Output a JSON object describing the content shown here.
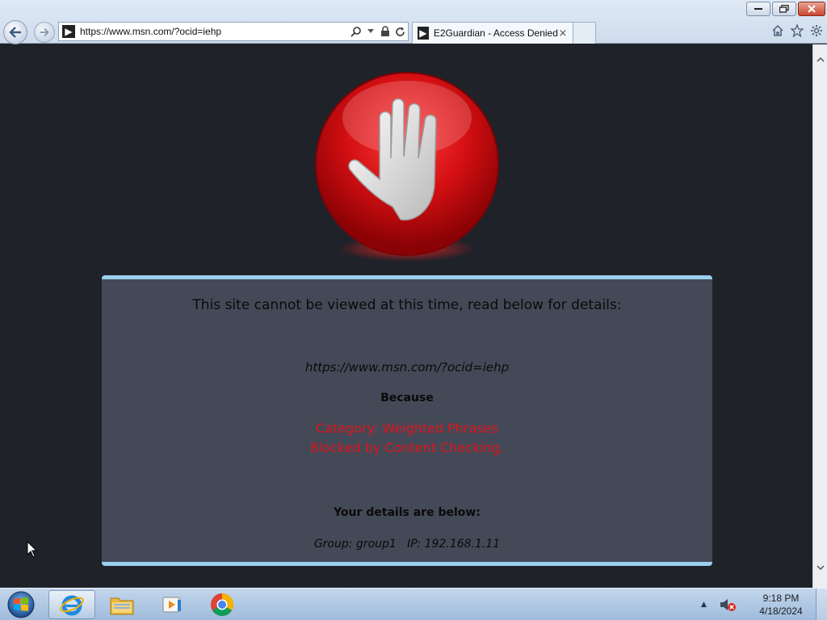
{
  "browser": {
    "address_url": "https://www.msn.com/?ocid=iehp",
    "tab_title": "E2Guardian - Access Denied",
    "tab_close": "×"
  },
  "page": {
    "heading": "This site cannot be viewed at this time, read below for details:",
    "blocked_url": "https://www.msn.com/?ocid=iehp",
    "because_label": "Because",
    "reason_category": "Category: Weighted Phrases",
    "reason_detail": "Blocked by Content Checking.",
    "details_label": "Your details are below:",
    "details_info": "Group: group1   IP: 192.168.1.11"
  },
  "taskbar": {
    "time": "9:18 PM",
    "date": "4/18/2024"
  },
  "colors": {
    "page_bg": "#1f2229",
    "panel_bg": "#444957",
    "panel_border": "#9ad0ef",
    "reason_text": "#e0141b"
  }
}
